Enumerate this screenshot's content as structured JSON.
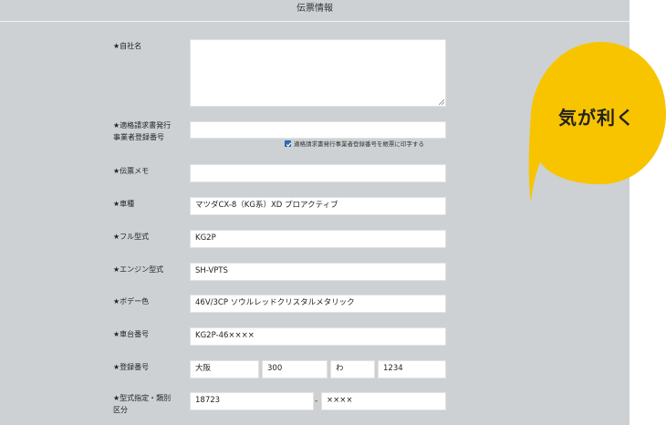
{
  "panel": {
    "title": "伝票情報"
  },
  "fields": {
    "company_name": {
      "label": "★自社名",
      "value": ""
    },
    "invoice_registration": {
      "label_line1": "★適格請求書発行",
      "label_line2": "事業者登録番号",
      "value": ""
    },
    "print_checkbox": {
      "label": "適格請求書発行事業者登録番号を帳票に印字する",
      "checked": true
    },
    "memo": {
      "label": "★伝票メモ",
      "value": ""
    },
    "vehicle_model": {
      "label": "★車種",
      "value": "マツダCX-8（KG系）XD プロアクティブ"
    },
    "full_model_code": {
      "label": "★フル型式",
      "value": "KG2P"
    },
    "engine_model": {
      "label": "★エンジン型式",
      "value": "SH-VPTS"
    },
    "body_color": {
      "label": "★ボデー色",
      "value": "46V/3CP ソウルレッドクリスタルメタリック"
    },
    "chassis_number": {
      "label": "★車台番号",
      "value": "KG2P-46××××"
    },
    "registration_number": {
      "label": "★登録番号",
      "part1": "大阪",
      "part2": "300",
      "part3": "わ",
      "part4": "1234"
    },
    "type_designation": {
      "label_line1": "★型式指定・類別",
      "label_line2": "区分",
      "value1": "18723",
      "separator": "-",
      "value2": "××××"
    }
  },
  "callout": {
    "text": "気が利く",
    "color": "#f8c400"
  }
}
